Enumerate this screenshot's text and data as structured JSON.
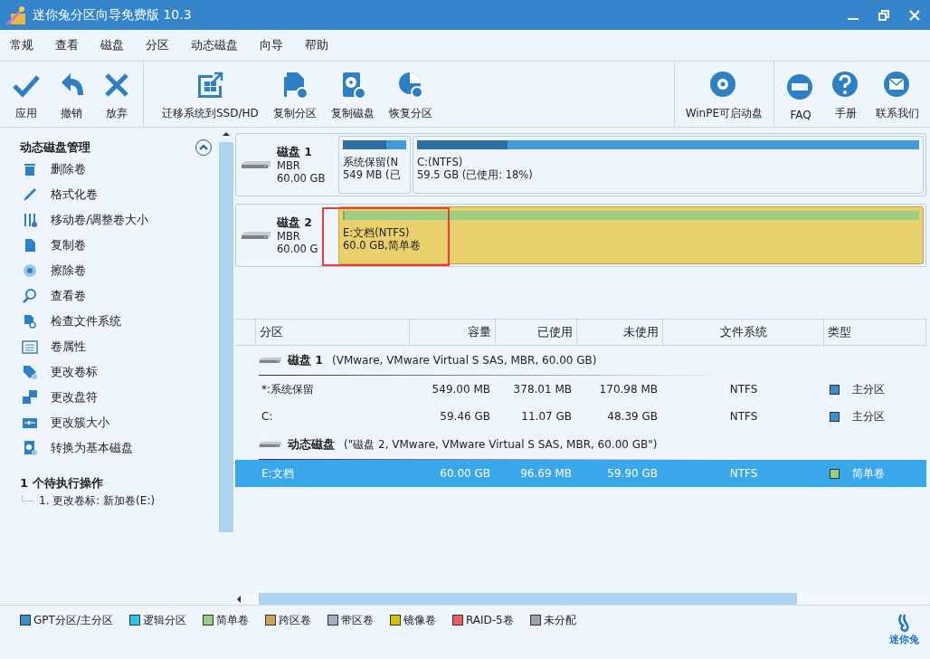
{
  "window": {
    "title": "迷你兔分区向导免费版 10.3"
  },
  "menu": [
    "常规",
    "查看",
    "磁盘",
    "分区",
    "动态磁盘",
    "向导",
    "帮助"
  ],
  "toolbar": [
    [
      {
        "label": "应用"
      },
      {
        "label": "撤销"
      },
      {
        "label": "放弃"
      }
    ],
    [
      {
        "label": "迁移系统到SSD/HD"
      },
      {
        "label": "复制分区"
      },
      {
        "label": "复制磁盘"
      },
      {
        "label": "恢复分区"
      }
    ],
    [
      {
        "label": "WinPE可启动盘"
      }
    ],
    [
      {
        "label": "FAQ"
      },
      {
        "label": "手册"
      },
      {
        "label": "联系我们"
      }
    ]
  ],
  "sidebar": {
    "title": "动态磁盘管理",
    "expanded": true,
    "items": [
      "删除卷",
      "格式化卷",
      "移动卷/调整卷大小",
      "复制卷",
      "擦除卷",
      "查看卷",
      "检查文件系统",
      "卷属性",
      "更改卷标",
      "更改盘符",
      "更改簇大小",
      "转换为基本磁盘"
    ],
    "pending_title": "1 个待执行操作",
    "pending": [
      "1.  更改卷标:  新加卷(E:)"
    ]
  },
  "disks": [
    {
      "name": "磁盘 1",
      "scheme": "MBR",
      "size": "60.00 GB",
      "partitions": [
        {
          "kind": "primary",
          "label": "系统保留(N",
          "detail": "549 MB (已",
          "level": 0.69,
          "selected": false
        },
        {
          "kind": "primary",
          "label": "C:(NTFS)",
          "detail": "59.5 GB (已使用: 18%)",
          "level": 0.18,
          "selected": false
        }
      ]
    },
    {
      "name": "磁盘 2",
      "scheme": "MBR",
      "size": "60.00 G",
      "partitions": [
        {
          "kind": "simple",
          "label": "E:文档(NTFS)",
          "detail": "60.0 GB,简单卷",
          "level": 0.003,
          "selected": true
        }
      ]
    }
  ],
  "table": {
    "columns": [
      "分区",
      "容量",
      "已使用",
      "未使用",
      "文件系统",
      "类型"
    ],
    "groups": [
      {
        "disk": "磁盘 1",
        "info": "(VMware, VMware Virtual S SAS, MBR, 60.00 GB)",
        "rows": [
          {
            "name": "*:系统保留",
            "capacity": "549.00 MB",
            "used": "378.01 MB",
            "free": "170.98 MB",
            "fs": "NTFS",
            "type": "主分区",
            "color": "#3a8fd0",
            "selected": false
          },
          {
            "name": "C:",
            "capacity": "59.46 GB",
            "used": "11.07 GB",
            "free": "48.39 GB",
            "fs": "NTFS",
            "type": "主分区",
            "color": "#3a8fd0",
            "selected": false
          }
        ]
      },
      {
        "disk": "动态磁盘",
        "info": "(\"磁盘 2, VMware, VMware Virtual S SAS, MBR, 60.00 GB\")",
        "rows": [
          {
            "name": "E:文档",
            "capacity": "60.00 GB",
            "used": "96.69 MB",
            "free": "59.90 GB",
            "fs": "NTFS",
            "type": "简单卷",
            "color": "#9ccf85",
            "selected": true
          }
        ]
      }
    ]
  },
  "legend": [
    {
      "label": "GPT分区/主分区",
      "color": "#3a8fd0"
    },
    {
      "label": "逻辑分区",
      "color": "#2ec4e6"
    },
    {
      "label": "简单卷",
      "color": "#9ccf85"
    },
    {
      "label": "跨区卷",
      "color": "#c8a55a"
    },
    {
      "label": "带区卷",
      "color": "#a6aec6"
    },
    {
      "label": "镜像卷",
      "color": "#d7c200"
    },
    {
      "label": "RAID-5卷",
      "color": "#f25c5c"
    },
    {
      "label": "未分配",
      "color": "#a0a0a0"
    }
  ],
  "logo": {
    "text": "迷你兔"
  }
}
